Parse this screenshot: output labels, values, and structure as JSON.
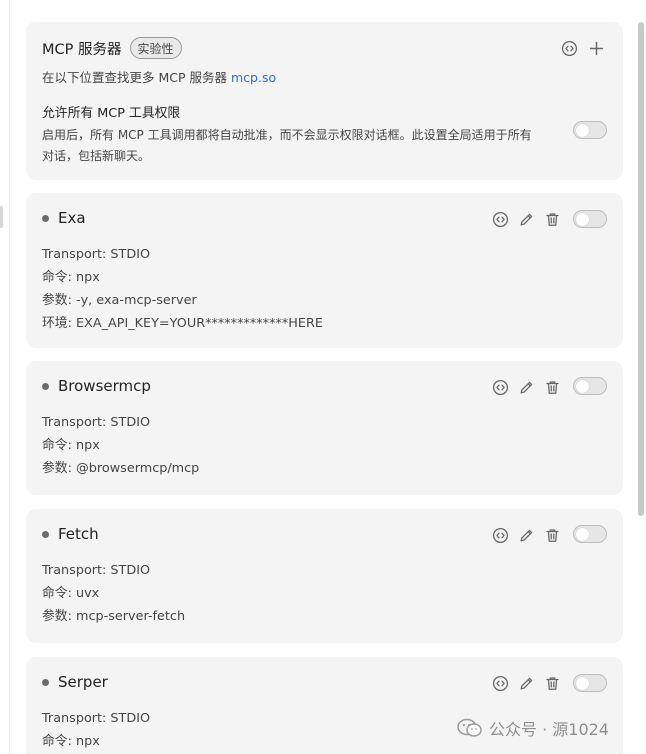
{
  "header": {
    "title": "MCP 服务器",
    "badge": "实验性",
    "find_more": "在以下位置查找更多 MCP 服务器",
    "find_more_link": "mcp.so",
    "allow_title": "允许所有 MCP 工具权限",
    "allow_desc": "启用后，所有 MCP 工具调用都将自动批准，而不会显示权限对话框。此设置全局适用于所有对话，包括新聊天。",
    "allow_enabled": false,
    "icons": [
      "code-icon",
      "plus-icon"
    ]
  },
  "servers": [
    {
      "name": "Exa",
      "transport": "Transport: STDIO",
      "command": "命令: npx",
      "args": "参数: -y, exa-mcp-server",
      "env": "环境: EXA_API_KEY=YOUR*************HERE",
      "enabled": false
    },
    {
      "name": "Browsermcp",
      "transport": "Transport: STDIO",
      "command": "命令: npx",
      "args": "参数: @browsermcp/mcp",
      "enabled": false
    },
    {
      "name": "Fetch",
      "transport": "Transport: STDIO",
      "command": "命令: uvx",
      "args": "参数: mcp-server-fetch",
      "enabled": false
    },
    {
      "name": "Serper",
      "transport": "Transport: STDIO",
      "command": "命令: npx",
      "enabled": false
    }
  ],
  "row_icons": [
    "code-icon",
    "edit-icon",
    "trash-icon"
  ],
  "watermark": "公众号 · 源1024",
  "colors": {
    "panel": "#f4f4f4",
    "link": "#2a6fd6",
    "toggle_off": "#e6e6e6"
  }
}
